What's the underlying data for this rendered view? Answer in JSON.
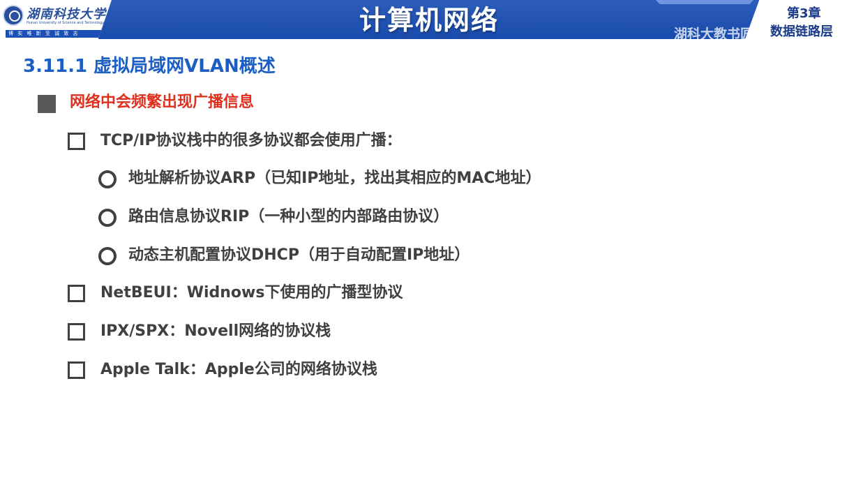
{
  "header": {
    "logo_text_cn": "湖南科技大学",
    "logo_text_en": "Hunan University of Science and Technology",
    "logo_motto": "博 实 唯 新    至 诚 致 志",
    "course_title": "计算机网络",
    "chapter_number": "第3章",
    "chapter_name": "数据链路层",
    "watermark": "湖科大教书匠"
  },
  "slide": {
    "section_title": "3.11.1 虚拟局域网VLAN概述",
    "point": "网络中会频繁出现广播信息",
    "items": [
      {
        "text": "TCP/IP协议栈中的很多协议都会使用广播：",
        "subitems": [
          "地址解析协议ARP（已知IP地址，找出其相应的MAC地址）",
          "路由信息协议RIP（一种小型的内部路由协议）",
          "动态主机配置协议DHCP（用于自动配置IP地址）"
        ]
      },
      {
        "text": "NetBEUI：Widnows下使用的广播型协议"
      },
      {
        "text": "IPX/SPX：Novell网络的协议栈"
      },
      {
        "text": "Apple Talk：Apple公司的网络协议栈"
      }
    ]
  },
  "colors": {
    "header_blue": "#1a4fb5",
    "section_title_blue": "#1b5fc4",
    "point_red": "#e02f1d",
    "body_text": "#404040"
  },
  "icons": {
    "level1_bullet": "filled-square-bullet",
    "level2_bullet": "hollow-square-bullet",
    "level3_bullet": "hollow-circle-bullet"
  }
}
